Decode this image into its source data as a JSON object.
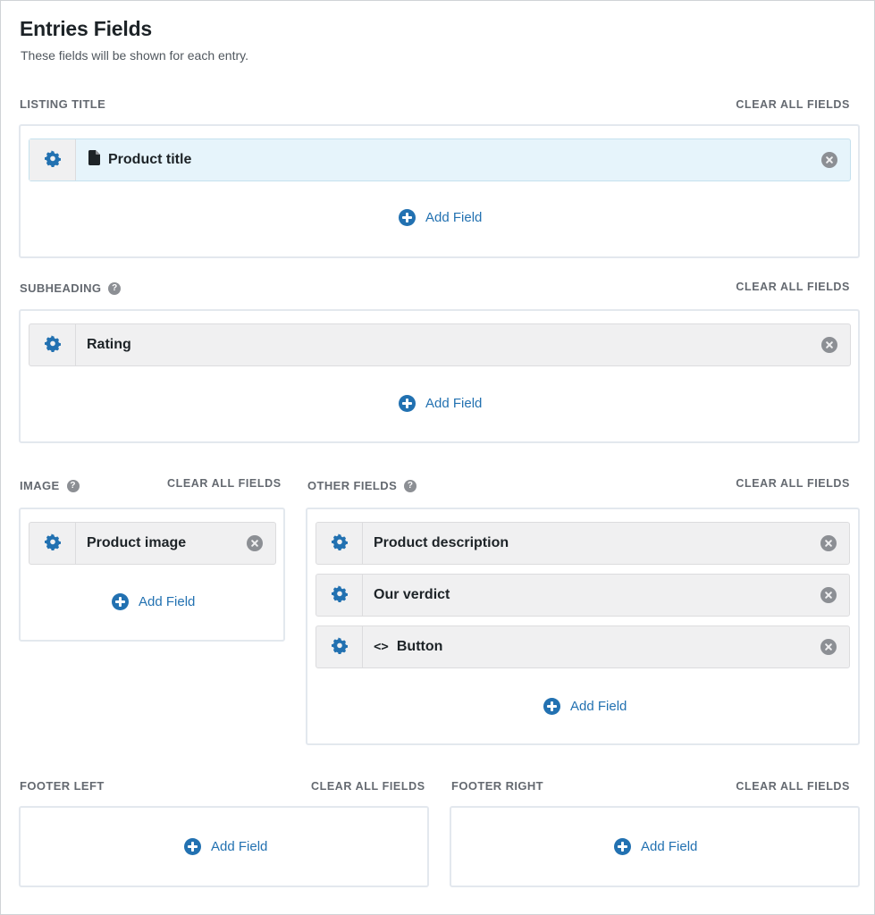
{
  "header": {
    "title": "Entries Fields",
    "subtitle": "These fields will be shown for each entry."
  },
  "common": {
    "clear_all": "CLEAR ALL FIELDS",
    "add_field": "Add Field",
    "help_glyph": "?"
  },
  "sections": {
    "listing_title": {
      "label": "LISTING TITLE",
      "fields": [
        {
          "label": "Product title",
          "icon": "document-icon",
          "active": true
        }
      ]
    },
    "subheading": {
      "label": "SUBHEADING",
      "fields": [
        {
          "label": "Rating"
        }
      ]
    },
    "image": {
      "label": "IMAGE",
      "fields": [
        {
          "label": "Product image"
        }
      ]
    },
    "other_fields": {
      "label": "OTHER FIELDS",
      "fields": [
        {
          "label": "Product description"
        },
        {
          "label": "Our verdict"
        },
        {
          "label": "Button",
          "icon": "code-icon",
          "icon_glyph": "<>"
        }
      ]
    },
    "footer_left": {
      "label": "FOOTER LEFT",
      "fields": []
    },
    "footer_right": {
      "label": "FOOTER RIGHT",
      "fields": []
    }
  },
  "colors": {
    "accent": "#2271b1",
    "active_field_bg": "#e6f4fb",
    "field_bg": "#f0f0f1",
    "label_gray": "#646970"
  }
}
